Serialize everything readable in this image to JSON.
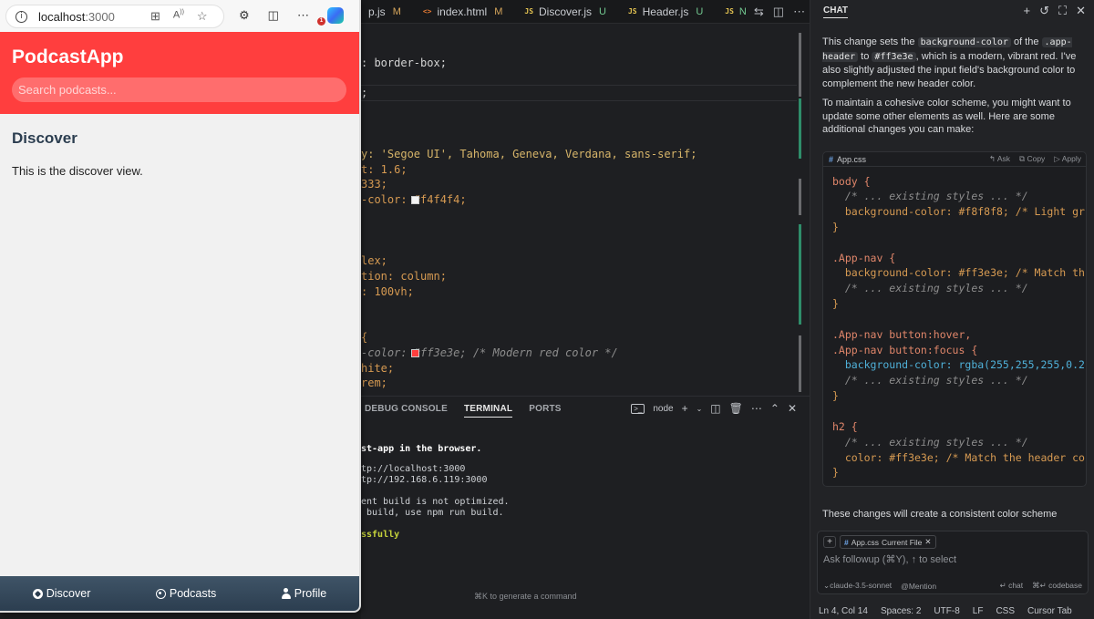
{
  "editor": {
    "tabs": [
      {
        "type": "JS",
        "name": "p.js",
        "status": "M"
      },
      {
        "type": "<>",
        "name": "index.html",
        "status": "M"
      },
      {
        "type": "JS",
        "name": "Discover.js",
        "status": "U"
      },
      {
        "type": "JS",
        "name": "Header.js",
        "status": "U"
      },
      {
        "type": "JS",
        "name": "N",
        "status": ""
      }
    ],
    "code_lines": [
      ": border-box;",
      ";",
      "y: 'Segoe UI', Tahoma, Geneva, Verdana, sans-serif;",
      "t: 1.6;",
      "333;",
      "-color: #f4f4f4;",
      "lex;",
      "tion: column;",
      ": 100vh;",
      "{",
      "-color: #ff3e3e; /* Modern red color */",
      "hite;",
      "rem;"
    ],
    "swatch_colors": [
      "#f4f4f4",
      "#ff3e3e"
    ],
    "panel": {
      "tabs": [
        "DEBUG CONSOLE",
        "TERMINAL",
        "PORTS"
      ],
      "active_tab": "TERMINAL",
      "terminal_name": "node",
      "terminal_lines": [
        "st-app in the browser.",
        "tp://localhost:3000",
        "tp://192.168.6.119:3000",
        "ent build is not optimized.",
        " build, use npm run build.",
        "ssfully"
      ],
      "hint": "⌘K to generate a command"
    }
  },
  "chat": {
    "title": "CHAT",
    "para1_parts": [
      "This change sets the ",
      "background-color",
      " of the ",
      ".app-header",
      " to ",
      "#ff3e3e",
      ", which is a modern, vibrant red. I've also slightly adjusted the input field's background color to complement the new header color."
    ],
    "para2": "To maintain a cohesive color scheme, you might want to update some other elements as well. Here are some additional changes you can make:",
    "code_block": {
      "filename": "App.css",
      "actions": [
        "Ask",
        "Copy",
        "Apply"
      ],
      "lines": [
        "body {",
        "  /* ... existing styles ... */",
        "  background-color: #f8f8f8; /* Light gr",
        "}",
        "",
        ".App-nav {",
        "  background-color: #ff3e3e; /* Match th",
        "  /* ... existing styles ... */",
        "}",
        "",
        ".App-nav button:hover,",
        ".App-nav button:focus {",
        "  background-color: rgba(255,255,255,0.2",
        "  /* ... existing styles ... */",
        "}",
        "",
        "h2 {",
        "  /* ... existing styles ... */",
        "  color: #ff3e3e; /* Match the header co",
        "}"
      ]
    },
    "para3": "These changes will create a consistent color scheme",
    "input": {
      "chip_file": "App.css",
      "chip_label": "Current File",
      "placeholder": "Ask followup (⌘Y), ↑ to select",
      "model": "claude-3.5-sonnet",
      "mention": "Mention",
      "chat_action": "chat",
      "codebase_action": "codebase"
    },
    "status": {
      "position": "Ln 4, Col 14",
      "spaces": "Spaces: 2",
      "encoding": "UTF-8",
      "eol": "LF",
      "language": "CSS",
      "cursor_tab": "Cursor Tab"
    }
  },
  "browser": {
    "url_host": "localhost",
    "url_port": ":3000",
    "notification_count": "1",
    "app": {
      "logo": "PodcastApp",
      "search_placeholder": "Search podcasts...",
      "heading": "Discover",
      "body_text": "This is the discover view.",
      "header_color": "#ff3e3e",
      "nav": [
        {
          "label": "Discover",
          "icon": "compass-icon"
        },
        {
          "label": "Podcasts",
          "icon": "podcast-icon"
        },
        {
          "label": "Profile",
          "icon": "user-icon"
        }
      ]
    }
  }
}
